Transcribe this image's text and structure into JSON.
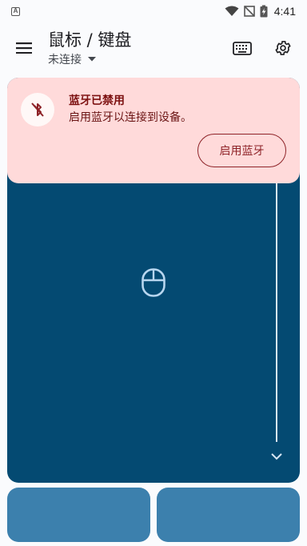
{
  "status_bar": {
    "notification_icon": "A",
    "time": "4:41",
    "icons": [
      "wifi-icon",
      "signal-off-icon",
      "battery-charging-icon"
    ]
  },
  "app_bar": {
    "title": "鼠标 / 键盘",
    "subtitle": "未连接",
    "icons": [
      "menu-icon",
      "chevron-down-icon",
      "keyboard-icon",
      "gear-icon"
    ]
  },
  "banner": {
    "title": "蓝牙已禁用",
    "text": "启用蓝牙以连接到设备。",
    "button_label": "启用蓝牙",
    "icon": "bluetooth-disabled-icon"
  },
  "touchpad": {
    "icon": "mouse-icon",
    "scroll_icon": "chevron-down-icon"
  },
  "colors": {
    "touchpad": "#044a72",
    "banner_bg": "#ffdada",
    "banner_text": "#7c1010",
    "buttons": "#3c80ad",
    "accent_line": "#d7e6f3"
  }
}
